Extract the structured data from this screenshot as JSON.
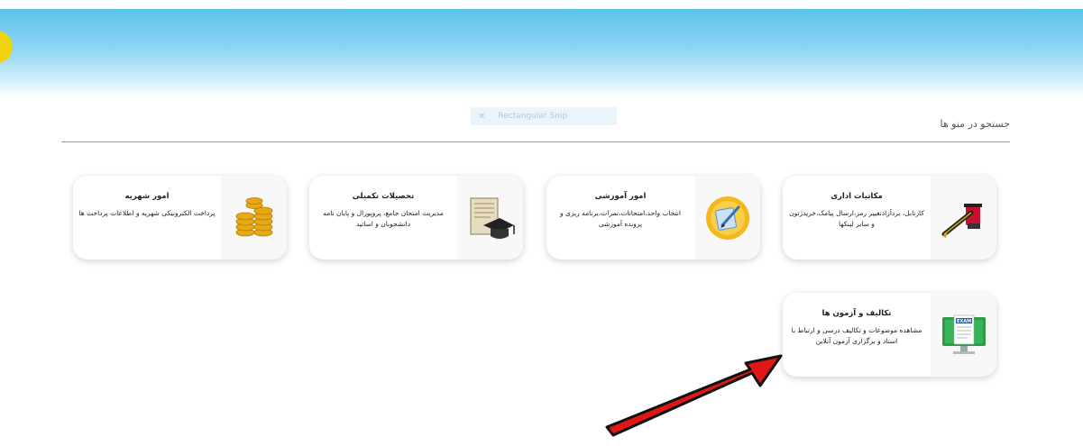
{
  "header": {
    "overlay_hint": "Rectangular Snip"
  },
  "search": {
    "label": "جستجو در منو ها"
  },
  "cards": [
    {
      "title": "مکاتبات اداری",
      "desc": "کارتابل، بردآزادتغییر رمز،ارسال پیامک،خریدژتون و سایر لینکها"
    },
    {
      "title": "امور آموزشی",
      "desc": "انتخاب واحد،امتحانات،نمرات،برنامه ریزی و پرونده آموزشی"
    },
    {
      "title": "تحصیلات تکمیلی",
      "desc": "مدیریت امتحان جامع، پروپوزال و پایان نامه دانشجویان و اساتید"
    },
    {
      "title": "امور شهریه",
      "desc": "پرداخت الکترونیکی شهریه و اطلاعات پرداخت ها"
    },
    {
      "title": "تکالیف و آزمون ها",
      "desc": "مشاهده موضوعات و تکالیف درسی و ارتباط با استاد و برگزاری آزمون آنلاین"
    }
  ],
  "icons": {
    "monitor_label": "EXAM"
  },
  "colors": {
    "arrow": "#e01717",
    "header": "#5cc3ea"
  }
}
